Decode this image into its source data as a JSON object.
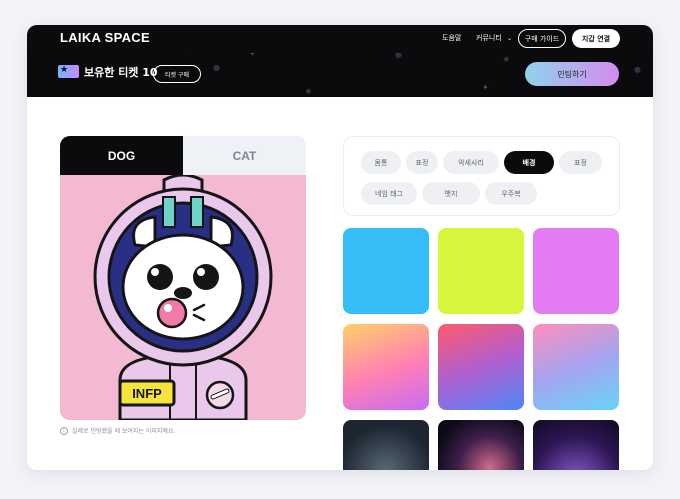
{
  "nav": {
    "logo": "LAIKA SPACE",
    "links": [
      "도움말",
      "커뮤니티"
    ],
    "guide_button": "구매 가이드",
    "wallet_button": "지갑 연결"
  },
  "banner": {
    "ticket_label": "보유한 티켓 10",
    "buy_ticket_button": "티켓 구매",
    "mint_button": "민팅하기"
  },
  "preview": {
    "tabs": [
      "DOG",
      "CAT"
    ],
    "active_tab": "DOG",
    "badge_text": "INFP",
    "note": "실제로 민팅했을 때 보여지는 이미지예요.",
    "background_color": "#f3b8d2"
  },
  "categories": {
    "items": [
      "몸통",
      "표정",
      "악세사리",
      "배경",
      "표정",
      "네임 태그",
      "뱃지",
      "우주복"
    ],
    "active": "배경"
  },
  "swatches": [
    {
      "name": "sky-blue",
      "fill": "#35bdf8"
    },
    {
      "name": "lime",
      "fill": "#d9f43c"
    },
    {
      "name": "violet",
      "fill": "#e37cf2"
    },
    {
      "name": "yellow-pink-gradient",
      "fill": "linear-gradient(160deg,#ffd06a,#ff7fb3 55%,#c56cf5)"
    },
    {
      "name": "red-blue-gradient",
      "fill": "linear-gradient(160deg,#ff5a6d,#b05fd0 50%,#4f86f7)"
    },
    {
      "name": "pink-cyan-gradient",
      "fill": "linear-gradient(160deg,#ff8fba,#a6a3f0 50%,#67d5f7)"
    },
    {
      "name": "starfield",
      "fill": "radial-gradient(circle at 50% 60%,#5a6a78,#1c2530 70%)"
    },
    {
      "name": "nebula",
      "fill": "radial-gradient(circle at 60% 55%,#d16a8a,#3d1f4a 45%,#0d0a18 80%)"
    },
    {
      "name": "purple-galaxy",
      "fill": "radial-gradient(circle at 50% 70%,#8a5ad0,#2a1550 60%,#120a24)"
    }
  ],
  "colors": {
    "nav_bg": "#0b0b0d",
    "accent_gradient": "#8fd3ea → #d58bf0"
  }
}
